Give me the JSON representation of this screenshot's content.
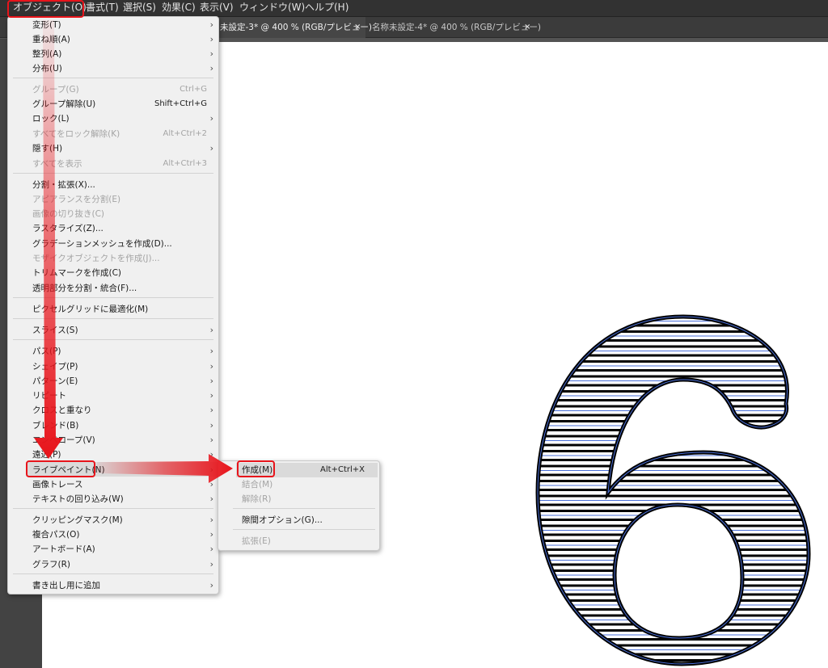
{
  "menubar": {
    "items": [
      {
        "label": "オブジェクト(O)"
      },
      {
        "label": "書式(T)"
      },
      {
        "label": "選択(S)"
      },
      {
        "label": "効果(C)"
      },
      {
        "label": "表示(V)"
      },
      {
        "label": "ウィンドウ(W)"
      },
      {
        "label": "ヘルプ(H)"
      }
    ]
  },
  "tabs": [
    {
      "label": "未設定-3* @ 400 % (RGB/プレビュー)",
      "close": "×"
    },
    {
      "label": "名称未設定-4* @ 400 % (RGB/プレビュー)",
      "close": "×"
    }
  ],
  "object_menu": {
    "items": [
      {
        "label": "変形(T)",
        "submenu": true
      },
      {
        "label": "重ね順(A)",
        "submenu": true
      },
      {
        "label": "整列(A)",
        "submenu": true
      },
      {
        "label": "分布(U)",
        "submenu": true
      },
      {
        "label": "グループ(G)",
        "shortcut": "Ctrl+G",
        "disabled": true
      },
      {
        "label": "グループ解除(U)",
        "shortcut": "Shift+Ctrl+G"
      },
      {
        "label": "ロック(L)",
        "submenu": true
      },
      {
        "label": "すべてをロック解除(K)",
        "shortcut": "Alt+Ctrl+2",
        "disabled": true
      },
      {
        "label": "隠す(H)",
        "submenu": true
      },
      {
        "label": "すべてを表示",
        "shortcut": "Alt+Ctrl+3",
        "disabled": true
      },
      {
        "label": "分割・拡張(X)..."
      },
      {
        "label": "アピアランスを分割(E)",
        "disabled": true
      },
      {
        "label": "画像の切り抜き(C)",
        "disabled": true
      },
      {
        "label": "ラスタライズ(Z)..."
      },
      {
        "label": "グラデーションメッシュを作成(D)..."
      },
      {
        "label": "モザイクオブジェクトを作成(J)...",
        "disabled": true
      },
      {
        "label": "トリムマークを作成(C)"
      },
      {
        "label": "透明部分を分割・統合(F)..."
      },
      {
        "label": "ピクセルグリッドに最適化(M)"
      },
      {
        "label": "スライス(S)",
        "submenu": true
      },
      {
        "label": "パス(P)",
        "submenu": true
      },
      {
        "label": "シェイプ(P)",
        "submenu": true
      },
      {
        "label": "パターン(E)",
        "submenu": true
      },
      {
        "label": "リピート",
        "submenu": true
      },
      {
        "label": "クロスと重なり",
        "submenu": true
      },
      {
        "label": "ブレンド(B)",
        "submenu": true
      },
      {
        "label": "エンベロープ(V)",
        "submenu": true
      },
      {
        "label": "遠近(P)",
        "submenu": true
      },
      {
        "label": "ライブペイント(N)",
        "submenu": true,
        "highlighted": true
      },
      {
        "label": "画像トレース",
        "submenu": true
      },
      {
        "label": "テキストの回り込み(W)",
        "submenu": true
      },
      {
        "label": "クリッピングマスク(M)",
        "submenu": true
      },
      {
        "label": "複合パス(O)",
        "submenu": true
      },
      {
        "label": "アートボード(A)",
        "submenu": true
      },
      {
        "label": "グラフ(R)",
        "submenu": true
      },
      {
        "label": "書き出し用に追加",
        "submenu": true
      }
    ]
  },
  "livepaint_submenu": {
    "items": [
      {
        "label": "作成(M)",
        "shortcut": "Alt+Ctrl+X",
        "highlighted": true
      },
      {
        "label": "結合(M)",
        "disabled": true
      },
      {
        "label": "解除(R)",
        "disabled": true
      },
      {
        "label": "隙間オプション(G)..."
      },
      {
        "label": "拡張(E)",
        "disabled": true
      }
    ]
  },
  "artwork": {
    "glyph": "6"
  },
  "colors": {
    "callout": "#e8141b",
    "selection": "#4a6fd8",
    "menu_bg": "#f0f0f0",
    "menubar_bg": "#323232"
  }
}
